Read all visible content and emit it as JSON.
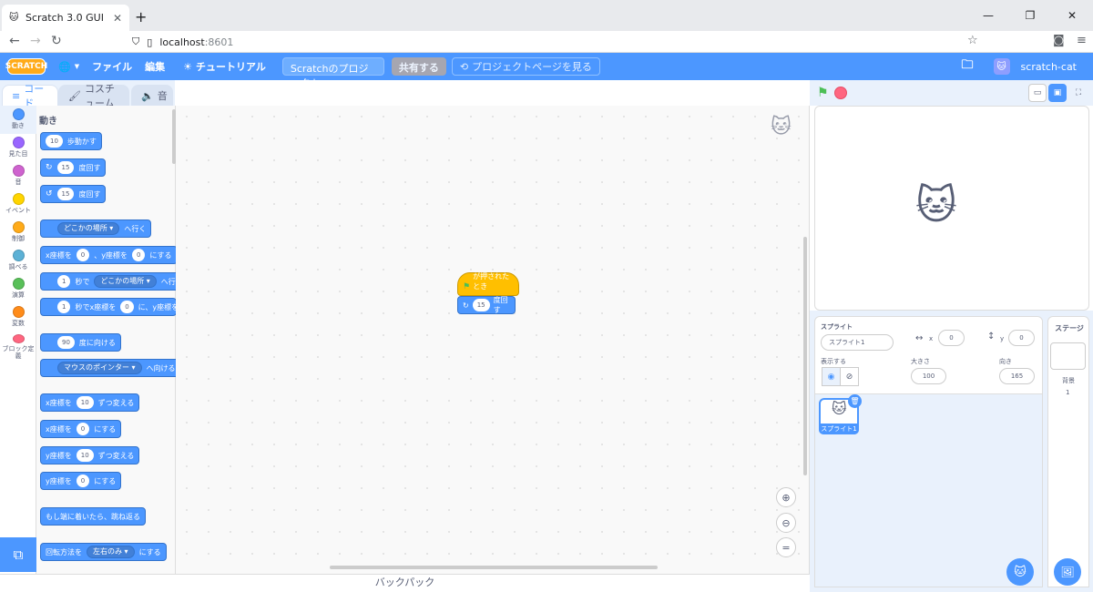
{
  "browser": {
    "tab_title": "Scratch 3.0 GUI",
    "url_host": "localhost",
    "url_port": ":8601"
  },
  "menubar": {
    "logo": "SCRATCH",
    "file": "ファイル",
    "edit": "編集",
    "tutorials": "チュートリアル",
    "project_title": "Scratchのプロジェクト",
    "share": "共有する",
    "project_page": "プロジェクトページを見る",
    "username": "scratch-cat"
  },
  "tabs": {
    "code": "コード",
    "costumes": "コスチューム",
    "sounds": "音"
  },
  "categories": [
    {
      "label": "動き",
      "color": "#4c97ff"
    },
    {
      "label": "見た目",
      "color": "#9966ff"
    },
    {
      "label": "音",
      "color": "#cf63cf"
    },
    {
      "label": "イベント",
      "color": "#ffd500"
    },
    {
      "label": "制御",
      "color": "#ffab19"
    },
    {
      "label": "調べる",
      "color": "#5cb1d6"
    },
    {
      "label": "演算",
      "color": "#59c059"
    },
    {
      "label": "変数",
      "color": "#ff8c1a"
    },
    {
      "label": "ブロック定義",
      "color": "#ff6680"
    }
  ],
  "palette": {
    "section": "動き",
    "move": {
      "value": "10",
      "text": "歩動かす"
    },
    "turn_right": {
      "value": "15",
      "text": "度回す"
    },
    "turn_left": {
      "value": "15",
      "text": "度回す"
    },
    "goto": {
      "dropdown": "どこかの場所",
      "text": "へ行く"
    },
    "goto_xy": {
      "pre": "x座標を",
      "x": "0",
      "mid": "、y座標を",
      "y": "0",
      "post": "にする"
    },
    "glide": {
      "value": "1",
      "mid": "秒で",
      "dropdown": "どこかの場所",
      "post": "へ行く"
    },
    "glide_xy": {
      "value": "1",
      "mid": "秒でx座標を",
      "x": "0",
      "mid2": "に、y座標を"
    },
    "point_dir": {
      "value": "90",
      "text": "度に向ける"
    },
    "point_towards": {
      "dropdown": "マウスのポインター",
      "text": "へ向ける"
    },
    "change_x": {
      "pre": "x座標を",
      "value": "10",
      "post": "ずつ変える"
    },
    "set_x": {
      "pre": "x座標を",
      "value": "0",
      "post": "にする"
    },
    "change_y": {
      "pre": "y座標を",
      "value": "10",
      "post": "ずつ変える"
    },
    "set_y": {
      "pre": "y座標を",
      "value": "0",
      "post": "にする"
    },
    "bounce": "もし端に着いたら、跳ね返る",
    "rotation": {
      "pre": "回転方法を",
      "dropdown": "左右のみ",
      "post": "にする"
    }
  },
  "workspace": {
    "hat_text": "が押されたとき",
    "turn_value": "15",
    "turn_text": "度回す",
    "backpack": "バックパック"
  },
  "sprite_info": {
    "sprite_label": "スプライト",
    "sprite_name": "スプライト1",
    "x_label": "x",
    "x_value": "0",
    "y_label": "y",
    "y_value": "0",
    "show_label": "表示する",
    "size_label": "大きさ",
    "size_value": "100",
    "direction_label": "向き",
    "direction_value": "165",
    "tile_name": "スプライト1"
  },
  "stage_panel": {
    "title": "ステージ",
    "backdrops_label": "背景",
    "backdrops_count": "1"
  },
  "icons": [
    "scratch-cat-icon",
    "globe-icon",
    "lightbulb-icon",
    "folder-icon",
    "green-flag-icon",
    "stop-icon",
    "trash-icon"
  ]
}
